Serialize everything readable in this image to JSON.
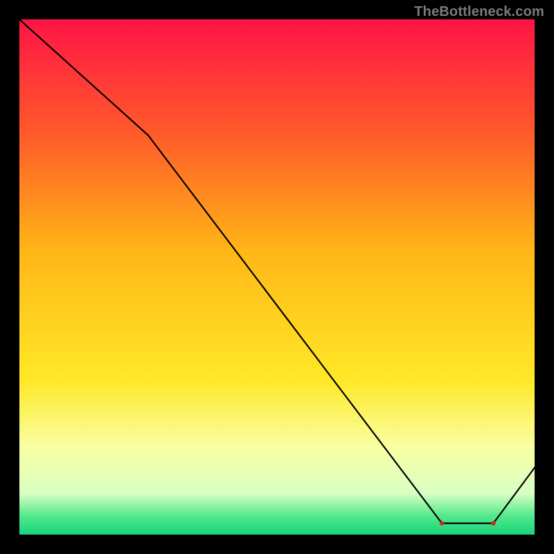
{
  "attribution": "TheBottleneck.com",
  "chart_data": {
    "type": "line",
    "title": "",
    "xlabel": "",
    "ylabel": "",
    "xlim": [
      0,
      100
    ],
    "ylim": [
      0,
      100
    ],
    "grid": false,
    "series": [
      {
        "name": "bottleneck-curve",
        "x": [
          0,
          25,
          82,
          92,
          100
        ],
        "values": [
          100,
          77.5,
          2.2,
          2.2,
          13
        ],
        "color": "#000000"
      }
    ],
    "markers": [
      {
        "name": "marker-a",
        "x": 82,
        "y": 2.2
      },
      {
        "name": "marker-b",
        "x": 92,
        "y": 2.2
      }
    ],
    "marker_label": "",
    "marker_label_x": 86,
    "marker_label_y": 2.2,
    "line_color": "#000000",
    "marker_color": "#e02020"
  },
  "gradient": {
    "stops": [
      {
        "offset": 0.0,
        "color": "#ff1446"
      },
      {
        "offset": 0.22,
        "color": "#ff5a2a"
      },
      {
        "offset": 0.45,
        "color": "#ffb617"
      },
      {
        "offset": 0.7,
        "color": "#ffe826"
      },
      {
        "offset": 0.83,
        "color": "#f9ffa3"
      },
      {
        "offset": 0.92,
        "color": "#d9ffc4"
      },
      {
        "offset": 0.965,
        "color": "#4fe88a"
      },
      {
        "offset": 1.0,
        "color": "#19d47d"
      }
    ]
  }
}
